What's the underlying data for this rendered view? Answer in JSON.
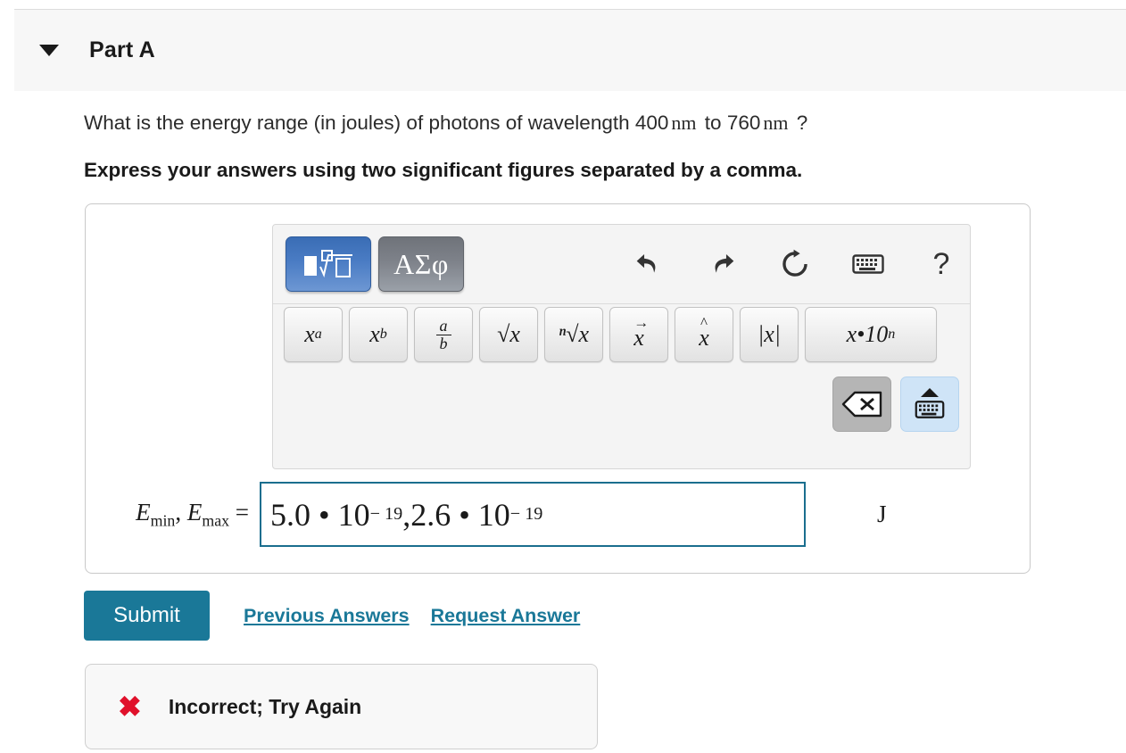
{
  "part": {
    "title": "Part A",
    "collapse_icon": "caret-down-icon"
  },
  "question": {
    "text_before": "What is the energy range (in joules) of photons of wavelength 400",
    "unit1": "nm",
    "text_middle": "to 760",
    "unit2": "nm",
    "text_after": "?",
    "instruction": "Express your answers using two significant figures separated by a comma."
  },
  "toolbar": {
    "mode_math_label": "math-template-icon",
    "mode_greek_label": "ΑΣφ",
    "icons": [
      {
        "name": "undo-icon",
        "label": "undo"
      },
      {
        "name": "redo-icon",
        "label": "redo"
      },
      {
        "name": "reset-icon",
        "label": "reset"
      },
      {
        "name": "keyboard-icon",
        "label": "keyboard"
      },
      {
        "name": "help-icon",
        "label": "?"
      }
    ],
    "symbols": [
      {
        "name": "superscript-button",
        "base": "x",
        "sup": "a"
      },
      {
        "name": "subscript-button",
        "base": "x",
        "sub": "b"
      },
      {
        "name": "fraction-button",
        "num": "a",
        "den": "b"
      },
      {
        "name": "square-root-button",
        "label": "√x"
      },
      {
        "name": "nth-root-button",
        "label": "ⁿ√x"
      },
      {
        "name": "vector-button",
        "base": "x",
        "over": "→"
      },
      {
        "name": "hat-button",
        "base": "x",
        "over": "^"
      },
      {
        "name": "absolute-value-button",
        "label": "|x|"
      },
      {
        "name": "scientific-notation-button",
        "base": "x•10",
        "sup": "n"
      }
    ],
    "backspace_label": "backspace-icon",
    "hide_keyboard_label": "hide-keyboard-icon"
  },
  "answer": {
    "label_e": "E",
    "label_min": "min",
    "label_max": "max",
    "label_full": "E min , E max =",
    "value_mantissa_1": "5.0 • 10",
    "value_exponent_1": "− 19",
    "value_separator": ",",
    "value_mantissa_2": "2.6 • 10",
    "value_exponent_2": "− 19",
    "unit": "J"
  },
  "actions": {
    "submit_label": "Submit",
    "previous_answers_label": "Previous Answers",
    "request_answer_label": "Request Answer"
  },
  "feedback": {
    "icon": "x-mark-icon",
    "icon_glyph": "✖",
    "message": "Incorrect; Try Again"
  },
  "colors": {
    "accent_teal": "#1a7898",
    "input_border": "#1a6e8e",
    "error_red": "#e0112b",
    "header_bg": "#f7f7f7",
    "mode_blue": "#4a7cc4"
  }
}
